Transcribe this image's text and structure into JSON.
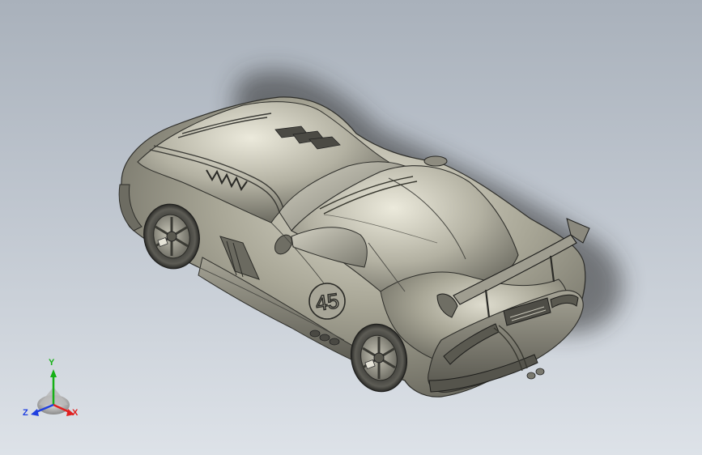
{
  "viewport": {
    "background_top": "#a9b1bb",
    "background_bottom": "#dde2e8"
  },
  "model": {
    "body_color": "#8d8c80",
    "highlight_color": "#dedcce",
    "shadow_color": "#3f3f3a",
    "race_number": "45"
  },
  "triad": {
    "x_label": "X",
    "y_label": "Y",
    "z_label": "Z",
    "x_color": "#e02020",
    "y_color": "#16b016",
    "z_color": "#2040e0"
  }
}
